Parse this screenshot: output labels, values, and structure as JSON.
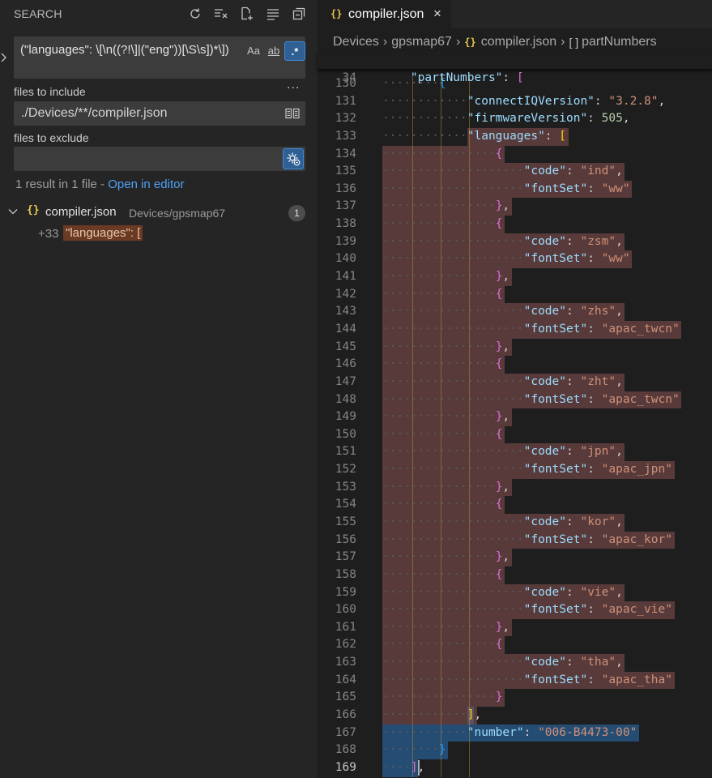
{
  "sidebar": {
    "title": "SEARCH",
    "actions": [
      {
        "icon": "refresh-icon"
      },
      {
        "icon": "clear-results-icon"
      },
      {
        "icon": "new-search-editor-icon"
      },
      {
        "icon": "view-as-tree-icon"
      },
      {
        "icon": "collapse-all-icon"
      }
    ],
    "search_query": "(\"languages\": \\[\\n((?!\\]|(\"eng\"))[\\S\\s])*\\])",
    "options": {
      "match_case": "Aa",
      "whole_word": "ab",
      "regex": ".*"
    },
    "more": "...",
    "include_label": "files to include",
    "include_value": "./Devices/**/compiler.json",
    "exclude_label": "files to exclude",
    "exclude_value": "",
    "result_summary": "1 result in 1 file - ",
    "open_in_editor": "Open in editor",
    "results": [
      {
        "file_icon": "{}",
        "file_name": "compiler.json",
        "file_path": "Devices/gpsmap67",
        "count": "1",
        "match_prefix": "+33",
        "match_text": "\"languages\": ["
      }
    ]
  },
  "editor": {
    "tab": {
      "icon": "{}",
      "label": "compiler.json",
      "close": "×"
    },
    "breadcrumb": [
      "Devices",
      "gpsmap67",
      "compiler.json",
      "partNumbers"
    ],
    "breadcrumb_json_icon": "{}",
    "breadcrumb_array_icon": "[ ]",
    "sticky": {
      "num": "34",
      "indent": "    ",
      "key": "\"partNumbers\"",
      "rest": ": ",
      "bracket": "["
    },
    "lines": [
      {
        "num": "130",
        "indent": "        ",
        "parts": [
          [
            "b2",
            "{"
          ]
        ]
      },
      {
        "num": "131",
        "indent": "            ",
        "parts": [
          [
            "k",
            "\"connectIQVersion\""
          ],
          [
            "p",
            ": "
          ],
          [
            "s",
            "\"3.2.8\""
          ],
          [
            "p",
            ","
          ]
        ]
      },
      {
        "num": "132",
        "indent": "            ",
        "parts": [
          [
            "k",
            "\"firmwareVersion\""
          ],
          [
            "p",
            ": "
          ],
          [
            "n",
            "505"
          ],
          [
            "p",
            ","
          ]
        ]
      },
      {
        "num": "133",
        "indent": "            ",
        "parts": [
          [
            "k",
            "\"languages\""
          ],
          [
            "p",
            ": "
          ],
          [
            "b3",
            "["
          ]
        ]
      },
      {
        "num": "134",
        "indent": "                ",
        "parts": [
          [
            "b1",
            "{"
          ]
        ]
      },
      {
        "num": "135",
        "indent": "                    ",
        "parts": [
          [
            "k",
            "\"code\""
          ],
          [
            "p",
            ": "
          ],
          [
            "s",
            "\"ind\""
          ],
          [
            "p",
            ","
          ]
        ]
      },
      {
        "num": "136",
        "indent": "                    ",
        "parts": [
          [
            "k",
            "\"fontSet\""
          ],
          [
            "p",
            ": "
          ],
          [
            "s",
            "\"ww\""
          ]
        ]
      },
      {
        "num": "137",
        "indent": "                ",
        "parts": [
          [
            "b1",
            "}"
          ],
          [
            "p",
            ","
          ]
        ]
      },
      {
        "num": "138",
        "indent": "                ",
        "parts": [
          [
            "b1",
            "{"
          ]
        ]
      },
      {
        "num": "139",
        "indent": "                    ",
        "parts": [
          [
            "k",
            "\"code\""
          ],
          [
            "p",
            ": "
          ],
          [
            "s",
            "\"zsm\""
          ],
          [
            "p",
            ","
          ]
        ]
      },
      {
        "num": "140",
        "indent": "                    ",
        "parts": [
          [
            "k",
            "\"fontSet\""
          ],
          [
            "p",
            ": "
          ],
          [
            "s",
            "\"ww\""
          ]
        ]
      },
      {
        "num": "141",
        "indent": "                ",
        "parts": [
          [
            "b1",
            "}"
          ],
          [
            "p",
            ","
          ]
        ]
      },
      {
        "num": "142",
        "indent": "                ",
        "parts": [
          [
            "b1",
            "{"
          ]
        ]
      },
      {
        "num": "143",
        "indent": "                    ",
        "parts": [
          [
            "k",
            "\"code\""
          ],
          [
            "p",
            ": "
          ],
          [
            "s",
            "\"zhs\""
          ],
          [
            "p",
            ","
          ]
        ]
      },
      {
        "num": "144",
        "indent": "                    ",
        "parts": [
          [
            "k",
            "\"fontSet\""
          ],
          [
            "p",
            ": "
          ],
          [
            "s",
            "\"apac_twcn\""
          ]
        ]
      },
      {
        "num": "145",
        "indent": "                ",
        "parts": [
          [
            "b1",
            "}"
          ],
          [
            "p",
            ","
          ]
        ]
      },
      {
        "num": "146",
        "indent": "                ",
        "parts": [
          [
            "b1",
            "{"
          ]
        ]
      },
      {
        "num": "147",
        "indent": "                    ",
        "parts": [
          [
            "k",
            "\"code\""
          ],
          [
            "p",
            ": "
          ],
          [
            "s",
            "\"zht\""
          ],
          [
            "p",
            ","
          ]
        ]
      },
      {
        "num": "148",
        "indent": "                    ",
        "parts": [
          [
            "k",
            "\"fontSet\""
          ],
          [
            "p",
            ": "
          ],
          [
            "s",
            "\"apac_twcn\""
          ]
        ]
      },
      {
        "num": "149",
        "indent": "                ",
        "parts": [
          [
            "b1",
            "}"
          ],
          [
            "p",
            ","
          ]
        ]
      },
      {
        "num": "150",
        "indent": "                ",
        "parts": [
          [
            "b1",
            "{"
          ]
        ]
      },
      {
        "num": "151",
        "indent": "                    ",
        "parts": [
          [
            "k",
            "\"code\""
          ],
          [
            "p",
            ": "
          ],
          [
            "s",
            "\"jpn\""
          ],
          [
            "p",
            ","
          ]
        ]
      },
      {
        "num": "152",
        "indent": "                    ",
        "parts": [
          [
            "k",
            "\"fontSet\""
          ],
          [
            "p",
            ": "
          ],
          [
            "s",
            "\"apac_jpn\""
          ]
        ]
      },
      {
        "num": "153",
        "indent": "                ",
        "parts": [
          [
            "b1",
            "}"
          ],
          [
            "p",
            ","
          ]
        ]
      },
      {
        "num": "154",
        "indent": "                ",
        "parts": [
          [
            "b1",
            "{"
          ]
        ]
      },
      {
        "num": "155",
        "indent": "                    ",
        "parts": [
          [
            "k",
            "\"code\""
          ],
          [
            "p",
            ": "
          ],
          [
            "s",
            "\"kor\""
          ],
          [
            "p",
            ","
          ]
        ]
      },
      {
        "num": "156",
        "indent": "                    ",
        "parts": [
          [
            "k",
            "\"fontSet\""
          ],
          [
            "p",
            ": "
          ],
          [
            "s",
            "\"apac_kor\""
          ]
        ]
      },
      {
        "num": "157",
        "indent": "                ",
        "parts": [
          [
            "b1",
            "}"
          ],
          [
            "p",
            ","
          ]
        ]
      },
      {
        "num": "158",
        "indent": "                ",
        "parts": [
          [
            "b1",
            "{"
          ]
        ]
      },
      {
        "num": "159",
        "indent": "                    ",
        "parts": [
          [
            "k",
            "\"code\""
          ],
          [
            "p",
            ": "
          ],
          [
            "s",
            "\"vie\""
          ],
          [
            "p",
            ","
          ]
        ]
      },
      {
        "num": "160",
        "indent": "                    ",
        "parts": [
          [
            "k",
            "\"fontSet\""
          ],
          [
            "p",
            ": "
          ],
          [
            "s",
            "\"apac_vie\""
          ]
        ]
      },
      {
        "num": "161",
        "indent": "                ",
        "parts": [
          [
            "b1",
            "}"
          ],
          [
            "p",
            ","
          ]
        ]
      },
      {
        "num": "162",
        "indent": "                ",
        "parts": [
          [
            "b1",
            "{"
          ]
        ]
      },
      {
        "num": "163",
        "indent": "                    ",
        "parts": [
          [
            "k",
            "\"code\""
          ],
          [
            "p",
            ": "
          ],
          [
            "s",
            "\"tha\""
          ],
          [
            "p",
            ","
          ]
        ]
      },
      {
        "num": "164",
        "indent": "                    ",
        "parts": [
          [
            "k",
            "\"fontSet\""
          ],
          [
            "p",
            ": "
          ],
          [
            "s",
            "\"apac_tha\""
          ]
        ]
      },
      {
        "num": "165",
        "indent": "                ",
        "parts": [
          [
            "b1",
            "}"
          ]
        ]
      },
      {
        "num": "166",
        "indent": "            ",
        "parts": [
          [
            "b3",
            "]"
          ],
          [
            "p",
            ","
          ]
        ]
      },
      {
        "num": "167",
        "indent": "            ",
        "parts": [
          [
            "k",
            "\"number\""
          ],
          [
            "p",
            ": "
          ],
          [
            "s",
            "\"006-B4473-00\""
          ]
        ]
      },
      {
        "num": "168",
        "indent": "        ",
        "parts": [
          [
            "b2",
            "}"
          ]
        ]
      },
      {
        "num": "169",
        "indent": "    ",
        "parts": [
          [
            "b1",
            "]"
          ],
          [
            "p",
            ","
          ]
        ]
      }
    ]
  }
}
